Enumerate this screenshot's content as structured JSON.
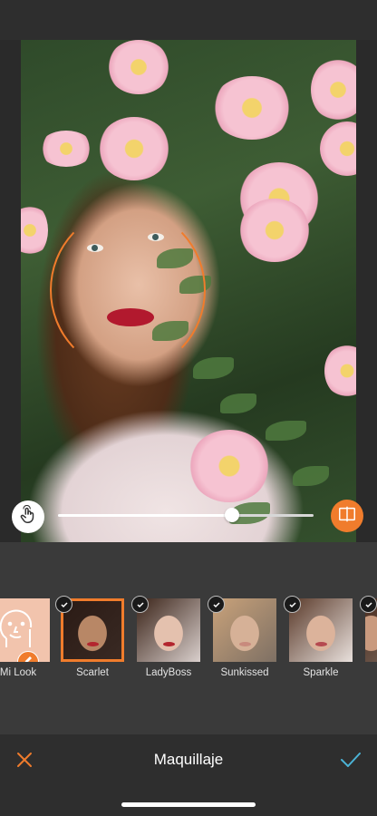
{
  "editor": {
    "title": "Maquillaje",
    "intensity_fraction": 0.68,
    "accent_color": "#f07c2c"
  },
  "looks": [
    {
      "label": "Mi Look",
      "icon": "face-outline-icon",
      "edit_icon": "pencil-icon"
    },
    {
      "label": "Scarlet",
      "selected": true,
      "downloaded": true
    },
    {
      "label": "LadyBoss",
      "downloaded": true
    },
    {
      "label": "Sunkissed",
      "downloaded": true
    },
    {
      "label": "Sparkle",
      "downloaded": true
    }
  ],
  "icons": {
    "touch": "hand-touch-icon",
    "compare": "split-compare-icon",
    "cancel": "close-icon",
    "confirm": "check-icon"
  }
}
